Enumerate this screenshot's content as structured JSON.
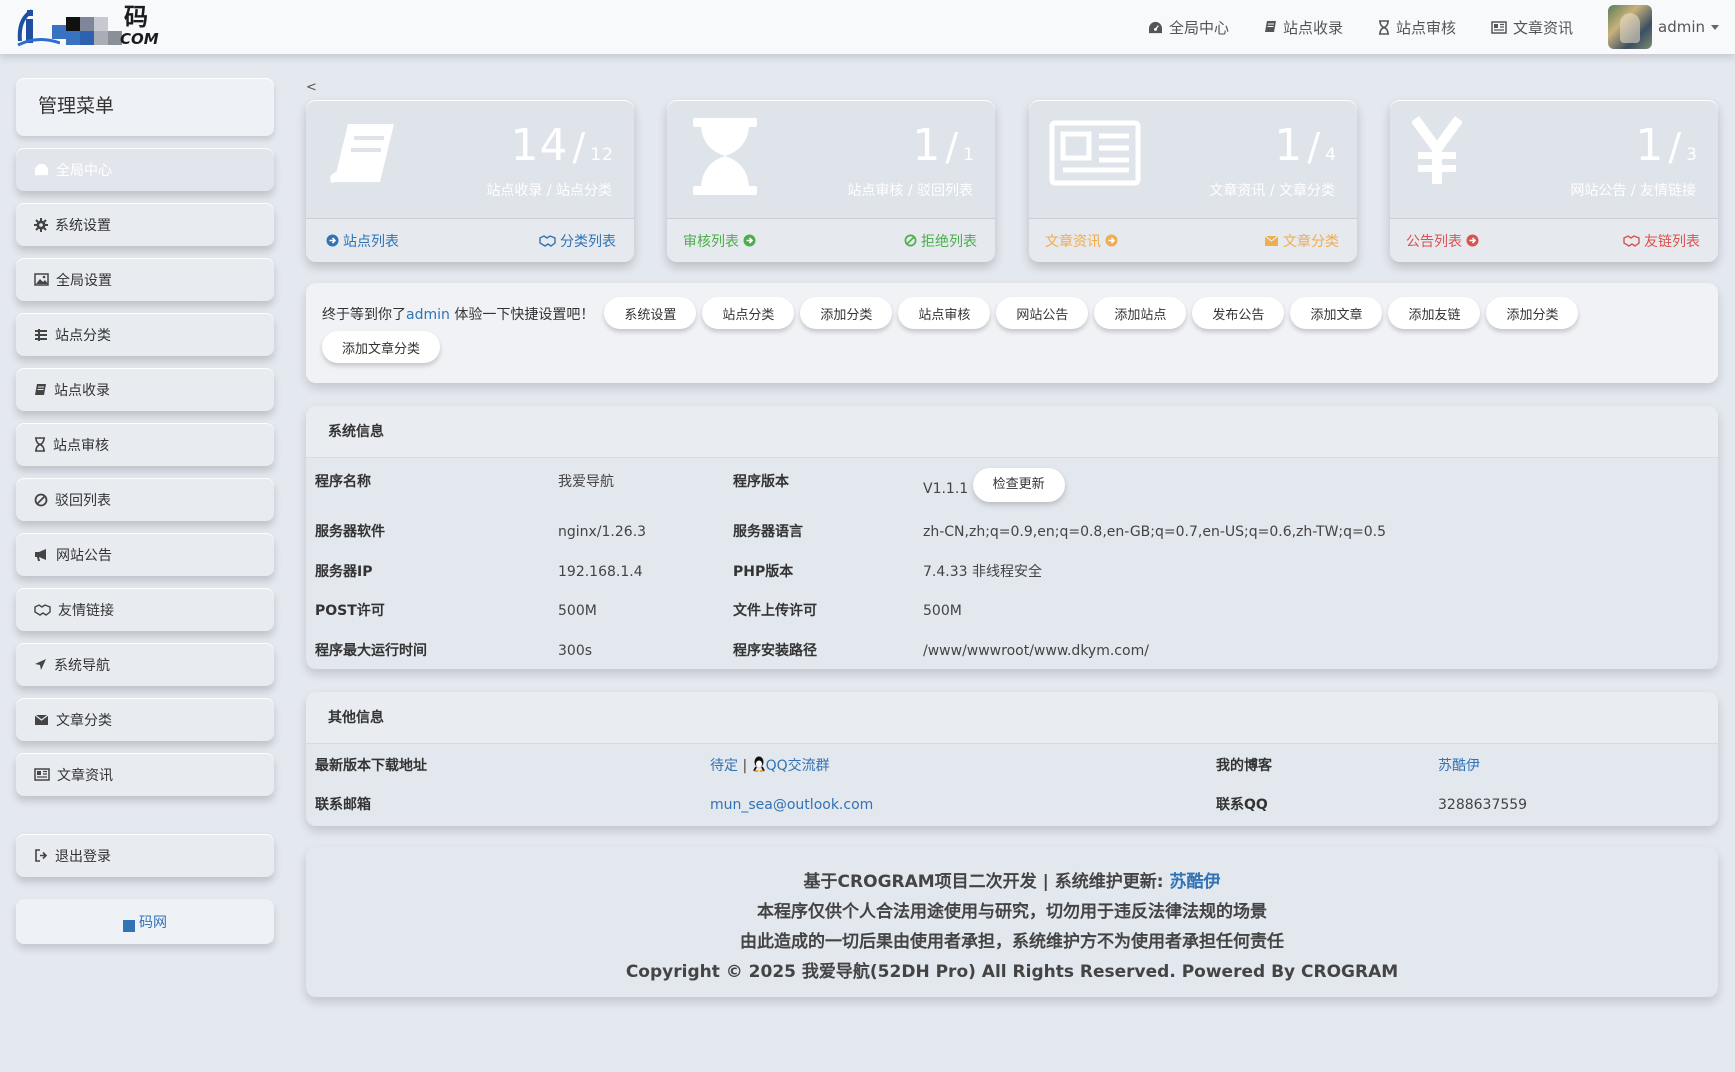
{
  "brand": {
    "logo_text": "码",
    "logo_com": "COM"
  },
  "topnav": [
    {
      "label": "全局中心",
      "icon": "dashboard-icon"
    },
    {
      "label": "站点收录",
      "icon": "book-icon"
    },
    {
      "label": "站点审核",
      "icon": "hourglass-icon"
    },
    {
      "label": "文章资讯",
      "icon": "newspaper-icon"
    }
  ],
  "user": {
    "name": "admin"
  },
  "sidebar": {
    "title": "管理菜单",
    "items": [
      {
        "label": "全局中心",
        "icon": "dashboard-icon"
      },
      {
        "label": "系统设置",
        "icon": "gear-icon"
      },
      {
        "label": "全局设置",
        "icon": "image-icon"
      },
      {
        "label": "站点分类",
        "icon": "tags-icon"
      },
      {
        "label": "站点收录",
        "icon": "book-icon"
      },
      {
        "label": "站点审核",
        "icon": "hourglass-icon"
      },
      {
        "label": "驳回列表",
        "icon": "ban-icon"
      },
      {
        "label": "网站公告",
        "icon": "bullhorn-icon"
      },
      {
        "label": "友情链接",
        "icon": "handshake-icon"
      },
      {
        "label": "系统导航",
        "icon": "location-arrow-icon"
      },
      {
        "label": "文章分类",
        "icon": "envelope-icon"
      },
      {
        "label": "文章资讯",
        "icon": "newspaper-icon"
      }
    ],
    "logout": "退出登录",
    "brand_label": "码网"
  },
  "back": "<",
  "stats": [
    {
      "num": "14",
      "total": "12",
      "sub": "站点收录 / 站点分类",
      "left_link": "站点列表",
      "right_link": "分类列表",
      "color": "#3173b4"
    },
    {
      "num": "1",
      "total": "1",
      "sub": "站点审核 / 驳回列表",
      "left_link": "审核列表",
      "right_link": "拒绝列表",
      "color": "#4cae4c"
    },
    {
      "num": "1",
      "total": "4",
      "sub": "文章资讯 / 文章分类",
      "left_link": "文章资讯",
      "right_link": "文章分类",
      "color": "#f0ad4e"
    },
    {
      "num": "1",
      "total": "3",
      "sub": "网站公告 / 友情链接",
      "left_link": "公告列表",
      "right_link": "友链列表",
      "color": "#d9534f"
    }
  ],
  "quick": {
    "text_before": "终于等到你了",
    "user": "admin",
    "text_after": " 体验一下快捷设置吧！",
    "buttons": [
      "系统设置",
      "站点分类",
      "添加分类",
      "站点审核",
      "网站公告",
      "添加站点",
      "发布公告",
      "添加文章",
      "添加友链",
      "添加分类",
      "添加文章分类"
    ]
  },
  "sysinfo": {
    "title": "系统信息",
    "rows": [
      {
        "l1": "程序名称",
        "v1": "我爱导航",
        "l2": "程序版本",
        "v2": "V1.1.1"
      },
      {
        "l1": "服务器软件",
        "v1": "nginx/1.26.3",
        "l2": "服务器语言",
        "v2": "zh-CN,zh;q=0.9,en;q=0.8,en-GB;q=0.7,en-US;q=0.6,zh-TW;q=0.5"
      },
      {
        "l1": "服务器IP",
        "v1": "192.168.1.4",
        "l2": "PHP版本",
        "v2": "7.4.33 非线程安全"
      },
      {
        "l1": "POST许可",
        "v1": "500M",
        "l2": "文件上传许可",
        "v2": "500M"
      },
      {
        "l1": "程序最大运行时间",
        "v1": "300s",
        "l2": "程序安装路径",
        "v2": "/www/wwwroot/www.dkym.com/"
      }
    ],
    "check_update": "检查更新"
  },
  "otherinfo": {
    "title": "其他信息",
    "download_label": "最新版本下载地址",
    "download_pending": "待定",
    "separator": " | ",
    "qq_group": "QQ交流群",
    "blog_label": "我的博客",
    "blog_value": "苏酷伊",
    "email_label": "联系邮箱",
    "email_value": "mun_sea@outlook.com",
    "qq_label": "联系QQ",
    "qq_value": "3288637559"
  },
  "footer": {
    "line1_a": "基于CROGRAM项目二次开发 | 系统维护更新: ",
    "line1_b": "苏酷伊",
    "line2": "本程序仅供个人合法用途使用与研究，切勿用于违反法律法规的场景",
    "line3": "由此造成的一切后果由使用者承担，系统维护方不为使用者承担任何责任",
    "line4": "Copyright © 2025 我爱导航(52DH Pro) All Rights Reserved. Powered By CROGRAM"
  }
}
